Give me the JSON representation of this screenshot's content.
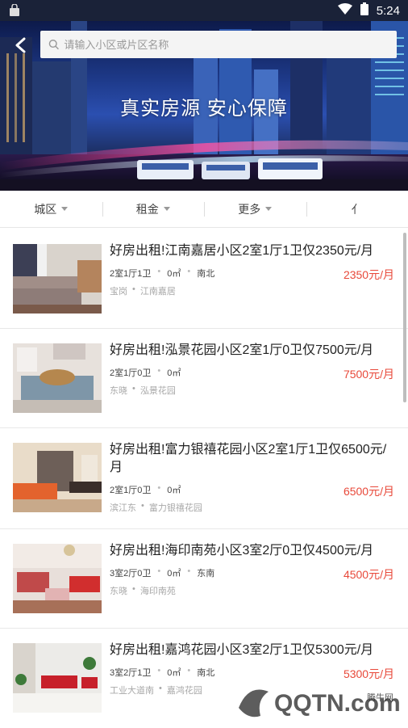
{
  "status_bar": {
    "time": "5:24"
  },
  "header": {
    "search_placeholder": "请输入小区或片区名称",
    "slogan": "真实房源 安心保障"
  },
  "filters": [
    {
      "label": "城区"
    },
    {
      "label": "租金"
    },
    {
      "label": "更多"
    },
    {
      "label": "⺅"
    }
  ],
  "listings": [
    {
      "title": "好房出租!江南嘉居小区2室1厅1卫仅2350元/月",
      "layout": "2室1厅1卫",
      "area": "0㎡",
      "orientation": "南北",
      "district": "宝岗",
      "community": "江南嘉居",
      "price": "2350元/月"
    },
    {
      "title": "好房出租!泓景花园小区2室1厅0卫仅7500元/月",
      "layout": "2室1厅0卫",
      "area": "0㎡",
      "orientation": "",
      "district": "东晓",
      "community": "泓景花园",
      "price": "7500元/月"
    },
    {
      "title": "好房出租!富力银禧花园小区2室1厅1卫仅6500元/月",
      "layout": "2室1厅0卫",
      "area": "0㎡",
      "orientation": "",
      "district": "滨江东",
      "community": "富力银禧花园",
      "price": "6500元/月"
    },
    {
      "title": "好房出租!海印南苑小区3室2厅0卫仅4500元/月",
      "layout": "3室2厅0卫",
      "area": "0㎡",
      "orientation": "东南",
      "district": "东晓",
      "community": "海印南苑",
      "price": "4500元/月"
    },
    {
      "title": "好房出租!嘉鸿花园小区3室2厅1卫仅5300元/月",
      "layout": "3室2厅1卫",
      "area": "0㎡",
      "orientation": "南北",
      "district": "工业大道南",
      "community": "嘉鸿花园",
      "price": "5300元/月"
    }
  ],
  "watermark": {
    "brand": "QQTN.com",
    "site": "腾牛网"
  },
  "colors": {
    "price": "#e8493a",
    "status_bar": "#1a2238",
    "search_bg": "#f4f4f4"
  }
}
